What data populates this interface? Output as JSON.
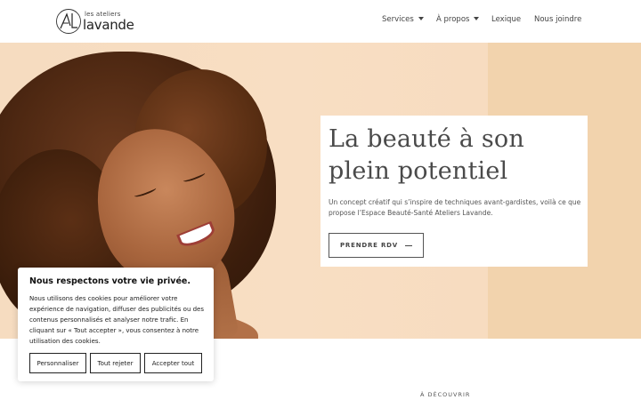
{
  "brand": {
    "small": "les ateliers",
    "name": "lavande"
  },
  "nav": {
    "services": "Services",
    "apropos": "À propos",
    "lexique": "Lexique",
    "contact": "Nous joindre"
  },
  "hero": {
    "title": "La beauté à son plein potentiel",
    "text": "Un concept créatif qui s’inspire de techniques avant-gardistes, voilà ce que propose l’Espace Beauté-Santé Ateliers Lavande.",
    "button": "PRENDRE RDV"
  },
  "section": {
    "discover": "À DÉCOUVRIR"
  },
  "cookie": {
    "title": "Nous respectons votre vie privée.",
    "text": "Nous utilisons des cookies pour améliorer votre expérience de navigation, diffuser des publicités ou des contenus personnalisés et analyser notre trafic. En cliquant sur « Tout accepter », vous consentez à notre utilisation des cookies.",
    "customize": "Personnaliser",
    "reject": "Tout rejeter",
    "accept": "Accepter tout"
  }
}
